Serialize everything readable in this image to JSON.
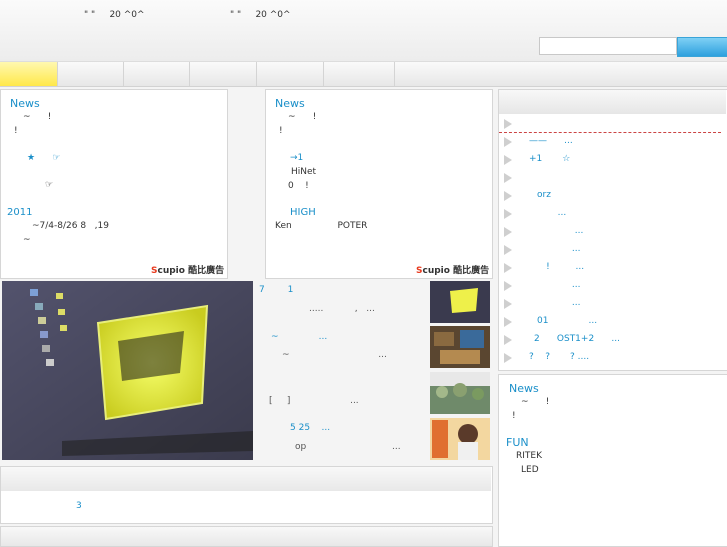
{
  "header": {
    "ticker_left": "\" \"     20 ^0^",
    "ticker_right": "\" \"     20 ^0^",
    "search_placeholder": "",
    "search_button_label": ""
  },
  "nav": {
    "tabs": [
      "",
      "",
      "",
      "",
      "",
      ""
    ]
  },
  "ad_left": {
    "title": "News",
    "lines": [
      "~      !",
      "!"
    ],
    "link1": "★      ☞",
    "line_arrow": "☞",
    "year": "2011",
    "dates": "~7/4-8/26 8   ,19",
    "tilde": "~",
    "brand_s": "S",
    "brand_rest": "cupio 酷比廣告"
  },
  "ad_right": {
    "title": "News",
    "lines": [
      "~      !",
      "!"
    ],
    "link1": "→1",
    "line_hinet": "HiNet",
    "line_zero": "0    !",
    "link2": "HIGH",
    "line_ken": "Ken                POTER",
    "brand_s": "S",
    "brand_rest": "cupio 酷比廣告"
  },
  "news": [
    {
      "title": "7        1",
      "desc": ".....           ,   ..."
    },
    {
      "title": "~              ...",
      "desc": "~                               ..."
    },
    {
      "title": "[     ]",
      "desc": "                     ..."
    },
    {
      "title": "5 25    ...",
      "desc": "op                              ..."
    }
  ],
  "sidebar": {
    "items": [
      "",
      "——      ...",
      "+1       ☆",
      "",
      "orz",
      "          ...",
      "                ...",
      "               ...",
      "      !         ...",
      "               ...",
      "               ...",
      "01              ...",
      "2      OST1+2      ...",
      "?    ?       ? ...."
    ]
  },
  "sidebar_ad": {
    "title": "News",
    "lines": [
      "~      !",
      "!"
    ],
    "fun": "FUN",
    "ritek": "RITEK",
    "led": "LED"
  },
  "bottom": {
    "item": "3"
  },
  "colors": {
    "link": "#1a8fc9",
    "accent_tab": "#ffe84a",
    "search_button": "#2ea0de"
  }
}
